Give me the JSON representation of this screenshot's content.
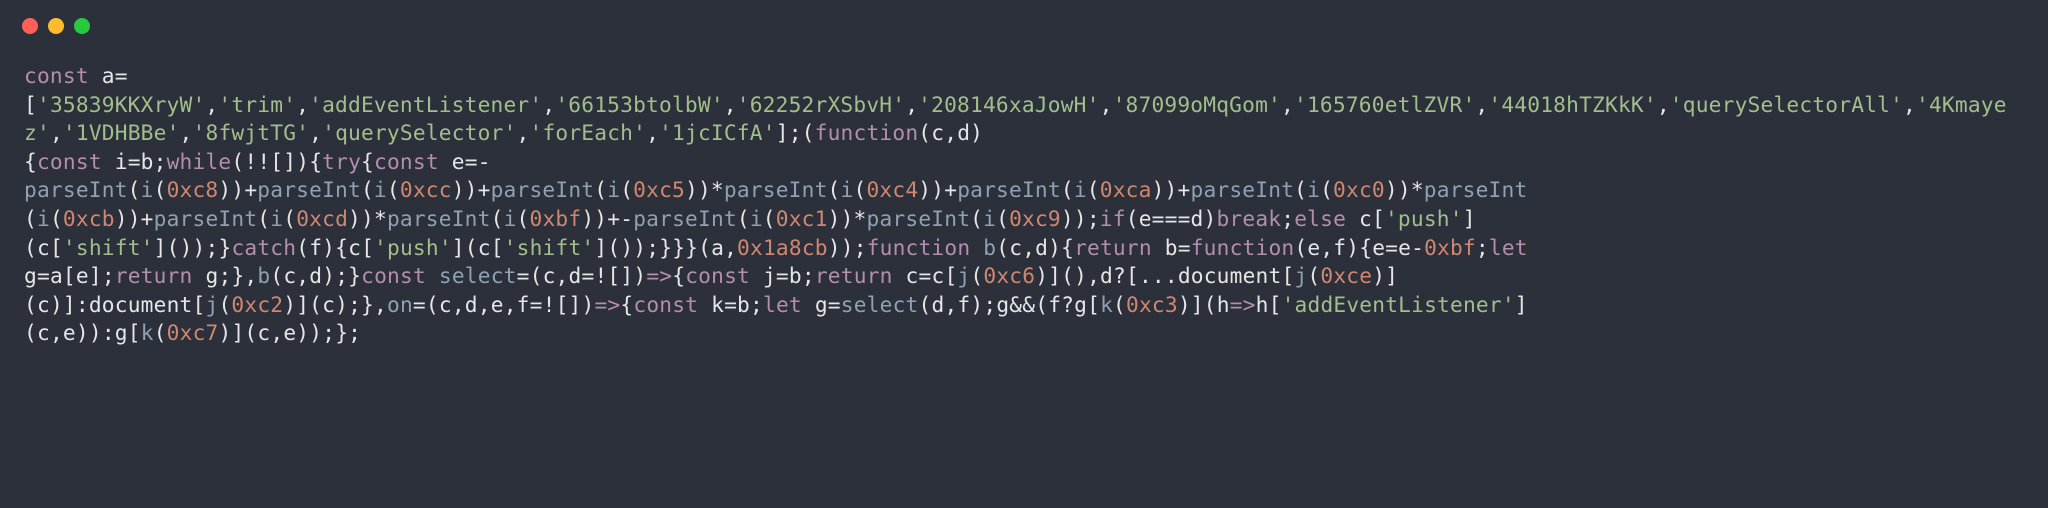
{
  "titlebar": {
    "red": "close",
    "yellow": "minimize",
    "green": "zoom"
  },
  "code": {
    "kw_const": "const",
    "sp": " ",
    "id_a": "a",
    "eq": "=",
    "nl": "\n",
    "lbr": "[",
    "q": "'",
    "s0": "35839KKXryW",
    "c": ",",
    "s1": "trim",
    "s2": "addEventListener",
    "s3": "66153btolbW",
    "s4": "62252rXSbvH",
    "s5": "208146xaJowH",
    "s6": "87099oMqGom",
    "s7": "165760etlZVR",
    "s8": "44018hTZKkK",
    "s9": "querySelectorAll",
    "s10": "4Kmayez",
    "s11": "1VDHBBe",
    "s12": "8fwjtTG",
    "s13": "querySelector",
    "s14": "forEach",
    "s15": "1jcICfA",
    "rbr": "]",
    "semi": ";",
    "lp": "(",
    "rp": ")",
    "kw_function": "function",
    "id_c": "c",
    "id_d": "d",
    "lcb": "{",
    "rcb": "}",
    "id_i": "i",
    "id_b": "b",
    "kw_while": "while",
    "bang": "!",
    "kw_try": "try",
    "id_e": "e",
    "minus": "-",
    "fn_parseInt": "parseInt",
    "hex_c8": "0xc8",
    "plus": "+",
    "hex_cc": "0xcc",
    "hex_c5": "0xc5",
    "star": "*",
    "hex_c4": "0xc4",
    "hex_ca": "0xca",
    "hex_c0": "0xc0",
    "hex_cb": "0xcb",
    "hex_cd": "0xcd",
    "hex_bf": "0xbf",
    "hex_c1": "0xc1",
    "hex_c9": "0xc9",
    "kw_if": "if",
    "eqeqeq": "===",
    "kw_break": "break",
    "kw_else": "else",
    "str_push": "push",
    "str_shift": "shift",
    "kw_catch": "catch",
    "id_f": "f",
    "hex_1a8cb": "0x1a8cb",
    "kw_return": "return",
    "kw_let": "kw_let",
    "let_txt": "let",
    "id_g": "g",
    "id_select": "select",
    "arrow": "=>",
    "id_j": "j",
    "hex_c6": "0xc6",
    "qmark": "?",
    "dots": "...",
    "id_document": "document",
    "hex_ce": "0xce",
    "colon": ":",
    "hex_c2": "0xc2",
    "id_on": "on",
    "id_k": "k",
    "hex_c3": "0xc3",
    "id_h": "h",
    "str_ael": "addEventListener",
    "hex_c7": "0xc7",
    "ampamp": "&&"
  }
}
